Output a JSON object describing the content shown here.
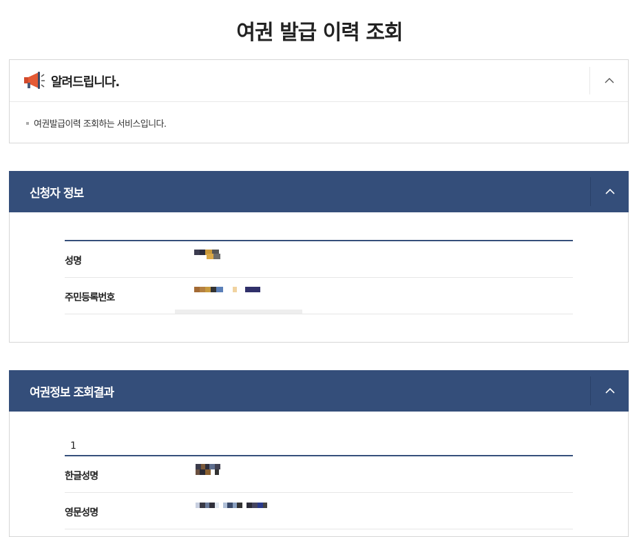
{
  "page": {
    "title": "여권 발급 이력 조회"
  },
  "notice": {
    "title": "알려드립니다.",
    "message": "여권발급이력 조회하는 서비스입니다.",
    "icon": "megaphone-icon",
    "toggle_icon": "chevron-up-icon"
  },
  "applicant": {
    "title": "신청자 정보",
    "rows": [
      {
        "label": "성명",
        "value_masked": true
      },
      {
        "label": "주민등록번호",
        "value_masked": true
      }
    ]
  },
  "passport_result": {
    "title": "여권정보 조회결과",
    "index": "1",
    "rows": [
      {
        "label": "한글성명",
        "value_masked": true
      },
      {
        "label": "영문성명",
        "value_masked": true
      }
    ]
  },
  "colors": {
    "header_bg": "#344e7a",
    "border": "#d6d6d6",
    "text": "#222222"
  }
}
